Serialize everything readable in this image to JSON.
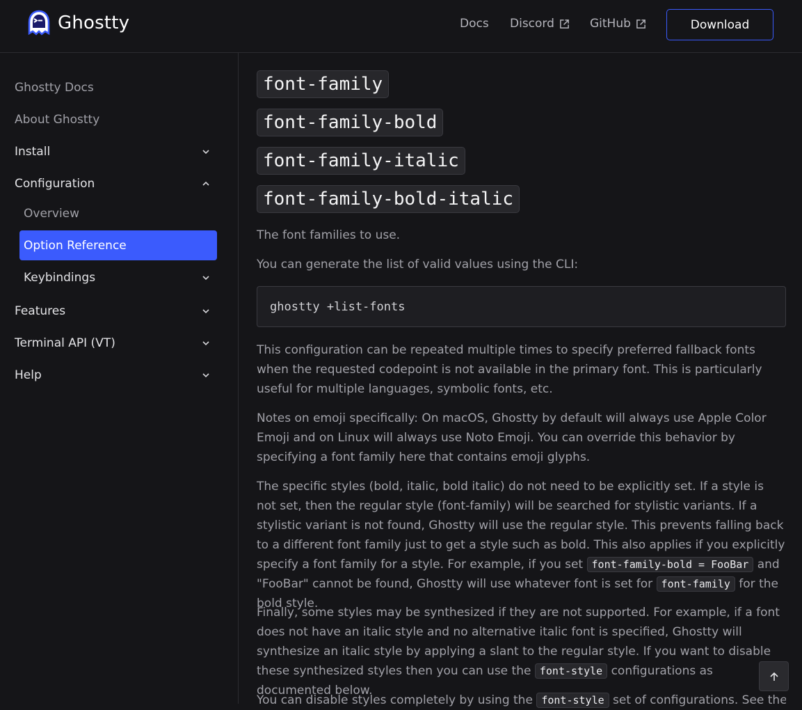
{
  "brand": {
    "name": "Ghostty"
  },
  "nav": {
    "docs": "Docs",
    "discord": "Discord",
    "github": "GitHub",
    "download": "Download"
  },
  "sidebar": {
    "items": [
      {
        "label": "Ghostty Docs"
      },
      {
        "label": "About Ghostty"
      },
      {
        "label": "Install"
      },
      {
        "label": "Configuration"
      },
      {
        "label": "Overview"
      },
      {
        "label": "Option Reference"
      },
      {
        "label": "Keybindings"
      },
      {
        "label": "Features"
      },
      {
        "label": "Terminal API (VT)"
      },
      {
        "label": "Help"
      }
    ]
  },
  "content": {
    "headings": [
      "font-family",
      "font-family-bold",
      "font-family-italic",
      "font-family-bold-italic"
    ],
    "p1": "The font families to use.",
    "p2": "You can generate the list of valid values using the CLI:",
    "code": "ghostty +list-fonts",
    "p3": "This configuration can be repeated multiple times to specify preferred fallback fonts when the requested codepoint is not available in the primary font. This is particularly useful for multiple languages, symbolic fonts, etc.",
    "p4": "Notes on emoji specifically: On macOS, Ghostty by default will always use Apple Color Emoji and on Linux will always use Noto Emoji. You can override this behavior by specifying a font family here that contains emoji glyphs.",
    "p5_a": "The specific styles (bold, italic, bold italic) do not need to be explicitly set. If a style is not set, then the regular style (font-family) will be searched for stylistic variants. If a stylistic variant is not found, Ghostty will use the regular style. This prevents falling back to a different font family just to get a style such as bold. This also applies if you explicitly specify a font family for a style. For example, if you set ",
    "p5_code1": "font-family-bold = FooBar",
    "p5_b": " and \"FooBar\" cannot be found, Ghostty will use whatever font is set for ",
    "p5_code2": "font-family",
    "p5_c": " for the bold style.",
    "p6_a": "Finally, some styles may be synthesized if they are not supported. For example, if a font does not have an italic style and no alternative italic font is specified, Ghostty will synthesize an italic style by applying a slant to the regular style. If you want to disable these synthesized styles then you can use the ",
    "p6_code": "font-style",
    "p6_b": " configurations as documented below.",
    "p7_a": "You can disable styles completely by using the ",
    "p7_code": "font-style",
    "p7_b": " set of configurations. See the"
  },
  "colors": {
    "accent": "#3b5bfd",
    "background": "#151518"
  },
  "icons": {
    "logo": "ghost-icon",
    "external": "external-link-icon",
    "chevron": "chevron-icon",
    "scroll_top": "arrow-up-icon"
  }
}
